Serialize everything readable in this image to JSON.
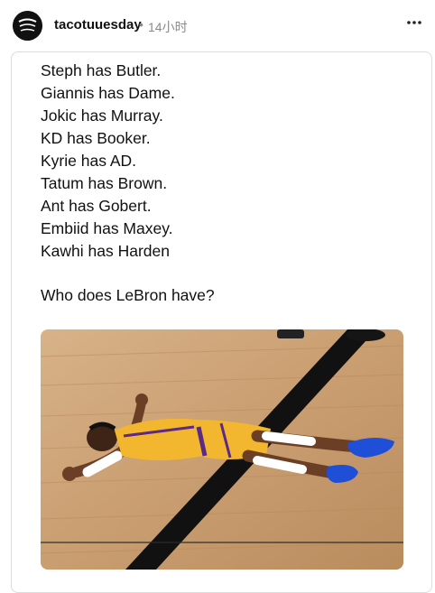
{
  "post": {
    "username": "tacotuuesday",
    "separator": "•",
    "timestamp": "14小时",
    "more_icon": "more-horizontal-icon",
    "lines": [
      "Steph has Butler.",
      "Giannis has Dame.",
      "Jokic has Murray.",
      "KD has Booker.",
      "Kyrie has AD.",
      "Tatum has Brown.",
      "Ant has Gobert.",
      "Embiid has Maxey.",
      "Kawhi has Harden"
    ],
    "question": "Who does LeBron have?"
  },
  "colors": {
    "username": "#111111",
    "meta": "#8a8a8a",
    "border": "#dcdcdc",
    "jersey_gold": "#f2b72e",
    "jersey_purple": "#5b2a86",
    "shoe_blue": "#1f4fd6",
    "court_wood": "#c9a071"
  }
}
